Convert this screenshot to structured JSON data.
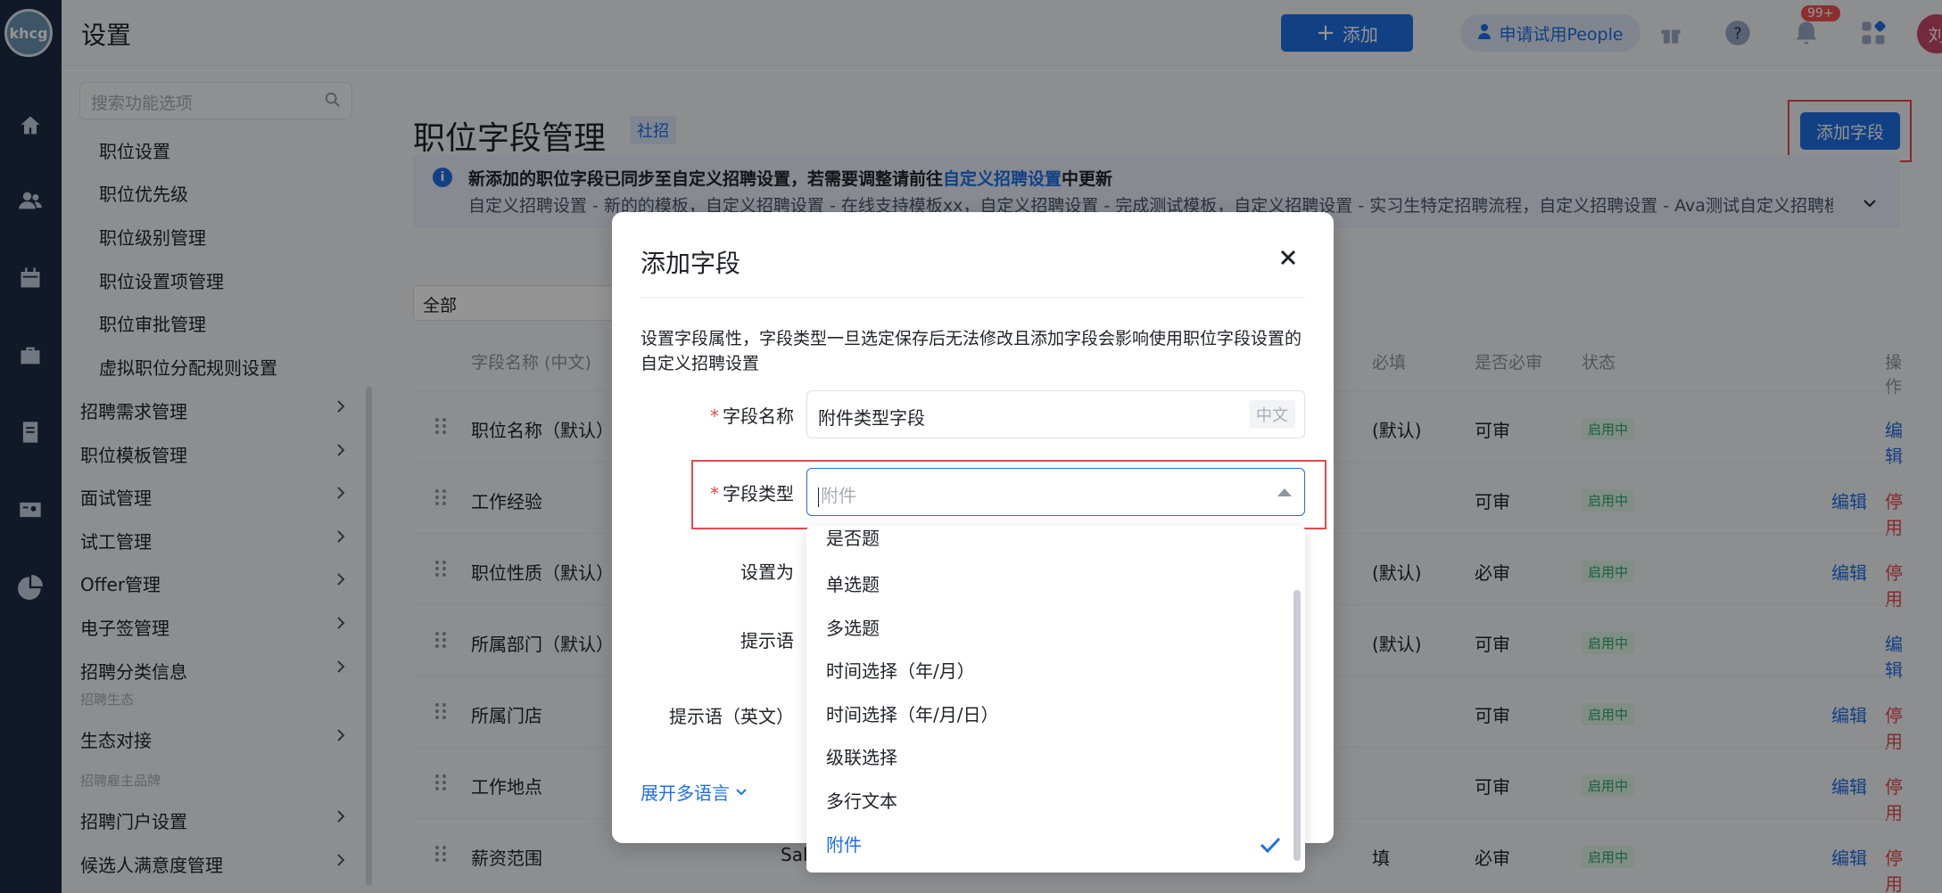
{
  "app": {
    "logo": "khcg",
    "header_title": "设置"
  },
  "header": {
    "add_label": "添加",
    "trial_label": "申请试用People",
    "notif_count": "99+",
    "avatar_text": "刘"
  },
  "side_menu": {
    "search_placeholder": "搜索功能选项",
    "sub_items": [
      "职位设置",
      "职位优先级",
      "职位级别管理",
      "职位设置项管理",
      "职位审批管理",
      "虚拟职位分配规则设置"
    ],
    "items": [
      "招聘需求管理",
      "职位模板管理",
      "面试管理",
      "试工管理",
      "Offer管理",
      "电子签管理",
      "招聘分类信息"
    ],
    "group1": "招聘生态",
    "group1_items": [
      "生态对接"
    ],
    "group2": "招聘雇主品牌",
    "group2_items": [
      "招聘门户设置",
      "候选人满意度管理"
    ]
  },
  "page": {
    "title": "职位字段管理",
    "tag": "社招",
    "add_field_button": "添加字段",
    "notice_bold_prefix": "新添加的职位字段已同步至自定义招聘设置，若需要调整请前往",
    "notice_link": "自定义招聘设置",
    "notice_bold_suffix": "中更新",
    "notice_line2": "自定义招聘设置 - 新的的模板，自定义招聘设置 - 在线支持模板xx，自定义招聘设置 - 完成测试模板，自定义招聘设置 - 实习生特定招聘流程，自定义招聘设置 - Ava测试自定义招聘模",
    "filter_value": "全部"
  },
  "table": {
    "headers": [
      "字段名称 (中文)",
      "必填",
      "是否必审",
      "状态",
      "操作"
    ],
    "rows": [
      {
        "name": "职位名称（默认）",
        "required": "(默认)",
        "audit": "可审",
        "status": "启用中",
        "edit": "编辑",
        "stop": ""
      },
      {
        "name": "工作经验",
        "required": "",
        "audit": "可审",
        "status": "启用中",
        "edit": "编辑",
        "stop": "停用"
      },
      {
        "name": "职位性质（默认）",
        "required": "(默认)",
        "audit": "必审",
        "status": "启用中",
        "edit": "编辑",
        "stop": "停用"
      },
      {
        "name": "所属部门（默认）",
        "required": "(默认)",
        "audit": "可审",
        "status": "启用中",
        "edit": "编辑",
        "stop": ""
      },
      {
        "name": "所属门店",
        "required": "",
        "audit": "可审",
        "status": "启用中",
        "edit": "编辑",
        "stop": "停用"
      },
      {
        "name": "工作地点",
        "required": "",
        "audit": "可审",
        "status": "启用中",
        "edit": "编辑",
        "stop": "停用"
      },
      {
        "name": "薪资范围",
        "required": "填",
        "audit": "必审",
        "status": "启用中",
        "edit": "编辑",
        "stop": "停用"
      }
    ],
    "row7_prefix": "Sal"
  },
  "modal": {
    "title": "添加字段",
    "description": "设置字段属性，字段类型一旦选定保存后无法修改且添加字段会影响使用职位字段设置的自定义招聘设置",
    "field_name_label": "字段名称",
    "field_name_value": "附件类型字段",
    "field_name_lang": "中文",
    "field_type_label": "字段类型",
    "field_type_placeholder": "附件",
    "set_as_label": "设置为",
    "hint_label": "提示语",
    "hint_en_label": "提示语（英文）",
    "expand_lang": "展开多语言"
  },
  "dropdown": {
    "options": [
      "是否题",
      "单选题",
      "多选题",
      "时间选择（年/月）",
      "时间选择（年/月/日）",
      "级联选择",
      "多行文本",
      "附件"
    ],
    "selected": "附件"
  }
}
